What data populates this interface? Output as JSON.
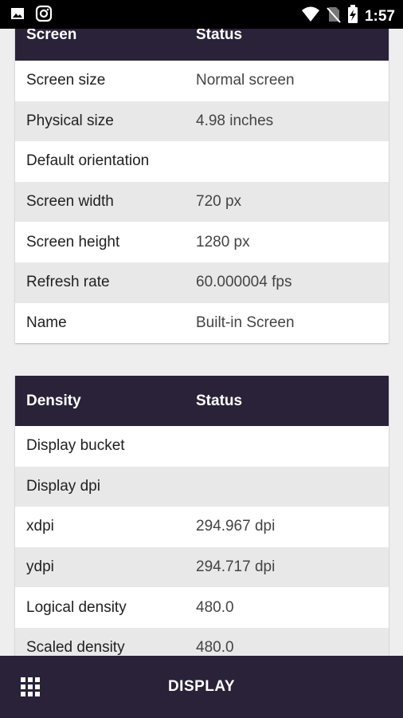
{
  "status_bar": {
    "time": "1:57",
    "icons": [
      "image-icon",
      "instagram-icon",
      "wifi-icon",
      "no-sim-icon",
      "battery-charging-icon"
    ]
  },
  "screen_card": {
    "header": {
      "col1": "Screen",
      "col2": "Status"
    },
    "rows": [
      {
        "label": "Screen size",
        "value": "Normal screen"
      },
      {
        "label": "Physical size",
        "value": "4.98 inches"
      },
      {
        "label": "Default orientation",
        "value": ""
      },
      {
        "label": "Screen width",
        "value": "720 px"
      },
      {
        "label": "Screen height",
        "value": "1280 px"
      },
      {
        "label": "Refresh rate",
        "value": "60.000004 fps"
      },
      {
        "label": "Name",
        "value": "Built-in Screen"
      }
    ]
  },
  "density_card": {
    "header": {
      "col1": "Density",
      "col2": "Status"
    },
    "rows": [
      {
        "label": "Display bucket",
        "value": ""
      },
      {
        "label": "Display dpi",
        "value": ""
      },
      {
        "label": "xdpi",
        "value": "294.967 dpi"
      },
      {
        "label": "ydpi",
        "value": "294.717 dpi"
      },
      {
        "label": "Logical density",
        "value": "480.0"
      },
      {
        "label": "Scaled density",
        "value": "480.0"
      }
    ]
  },
  "bottom_bar": {
    "title": "DISPLAY",
    "menu_icon": "grid-icon"
  }
}
